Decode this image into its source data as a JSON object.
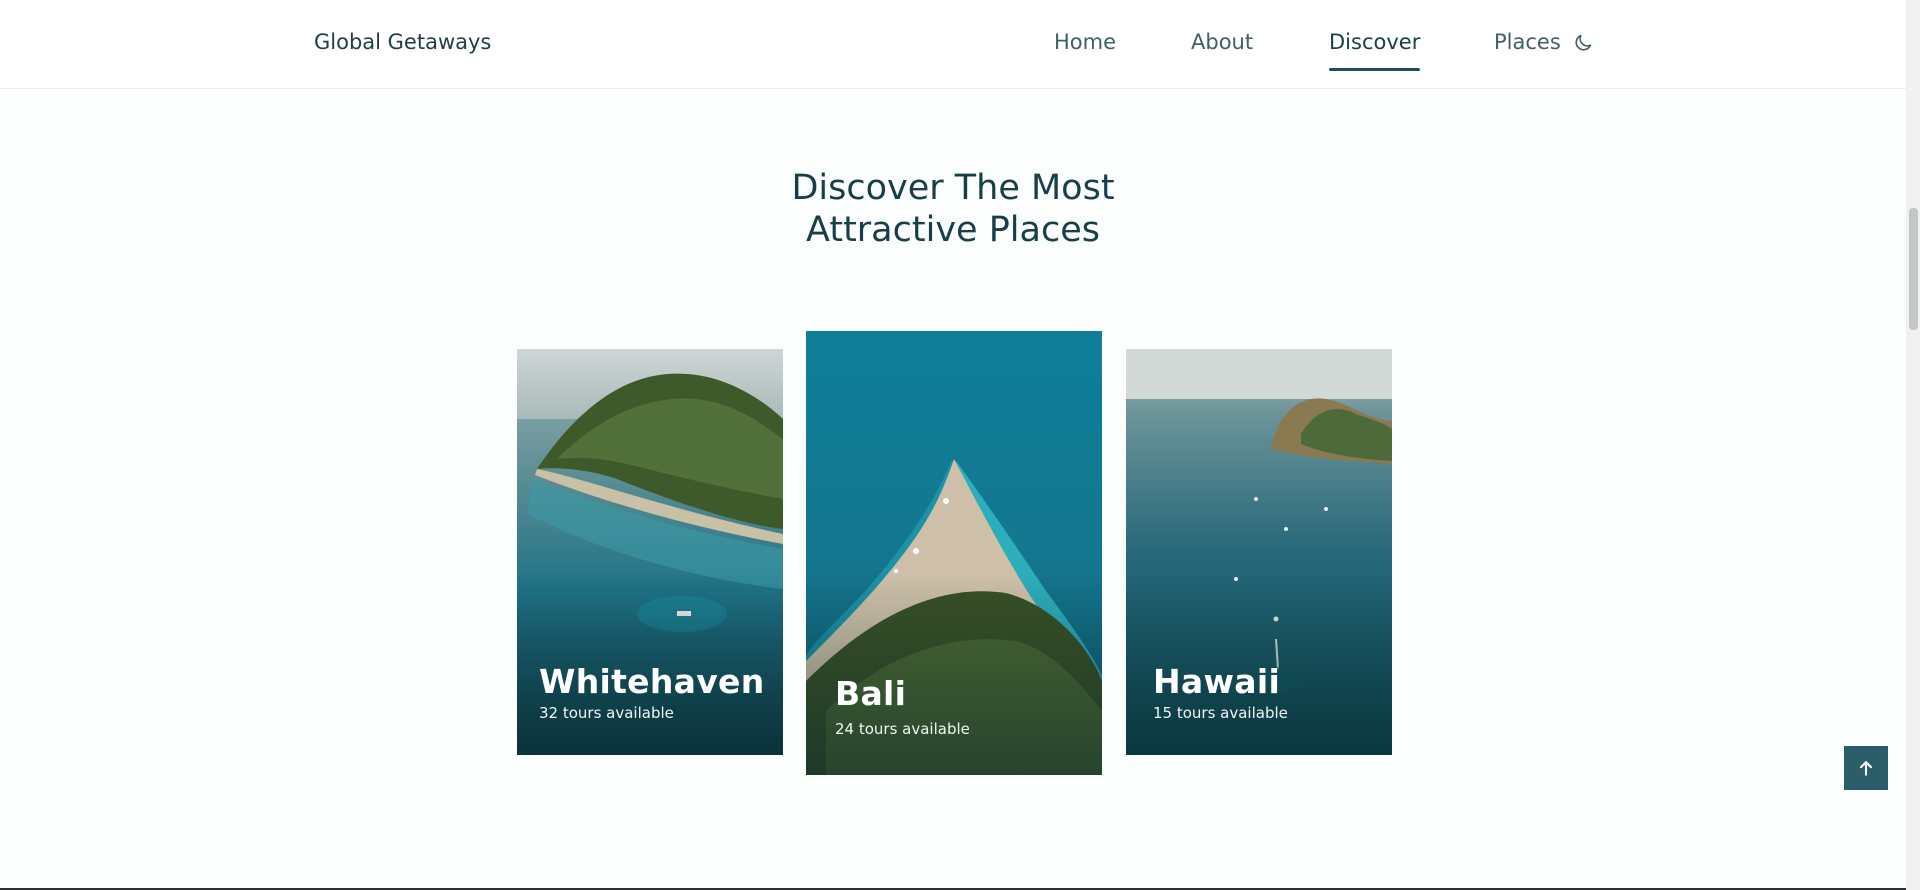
{
  "header": {
    "logo": "Global Getaways",
    "nav": [
      {
        "label": "Home",
        "active": false
      },
      {
        "label": "About",
        "active": false
      },
      {
        "label": "Discover",
        "active": true
      },
      {
        "label": "Places",
        "active": false
      }
    ],
    "theme_icon": "moon-icon"
  },
  "section": {
    "title_line1": "Discover The Most",
    "title_line2": "Attractive Places"
  },
  "cards": [
    {
      "name": "Whitehaven",
      "tours": "32 tours available"
    },
    {
      "name": "Bali",
      "tours": "24 tours available"
    },
    {
      "name": "Hawaii",
      "tours": "15 tours available"
    }
  ],
  "scroll_up": {
    "icon": "arrow-up-icon"
  },
  "colors": {
    "accent": "#1d4f5a",
    "button": "#2b5e69",
    "title": "#173f4a"
  }
}
